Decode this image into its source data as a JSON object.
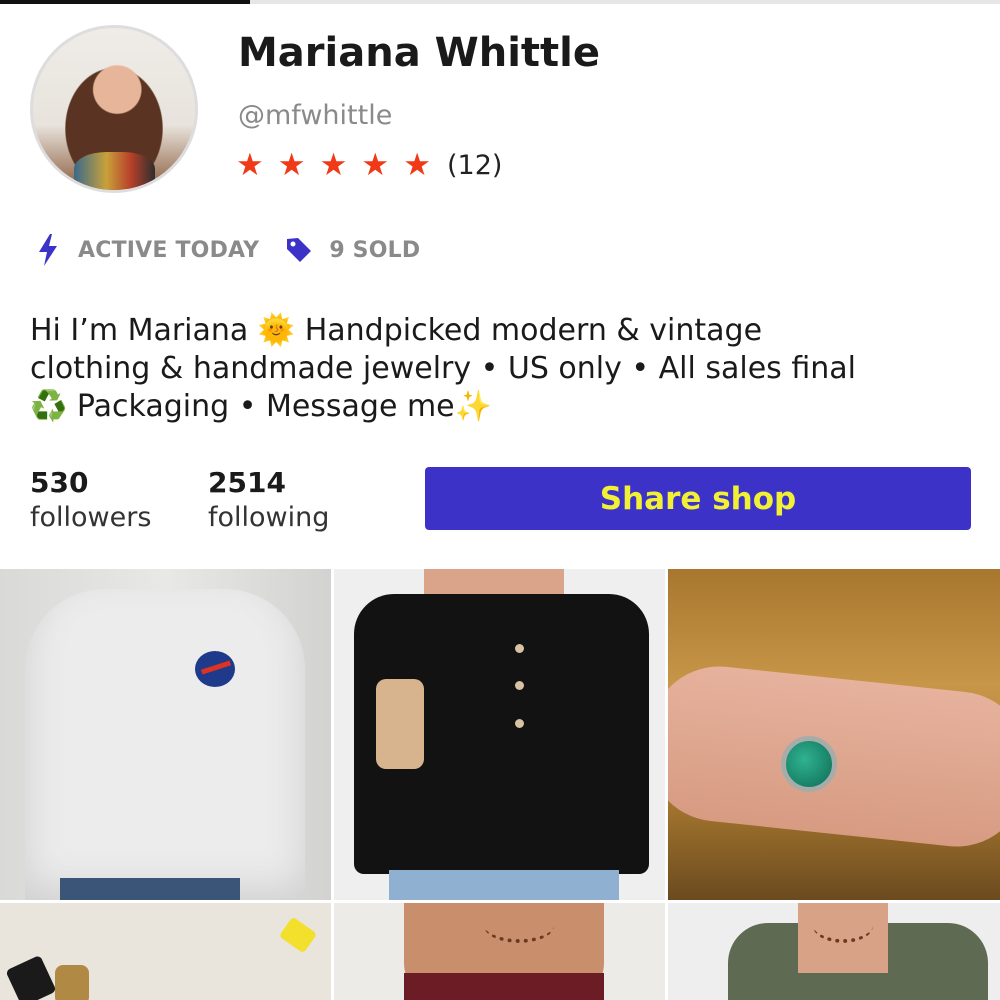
{
  "profile": {
    "name": "Mariana Whittle",
    "handle": "@mfwhittle",
    "rating": 5,
    "rating_count": "(12)",
    "star_color": "#f03a17"
  },
  "meta": {
    "active": {
      "icon": "lightning-icon",
      "label": "ACTIVE TODAY"
    },
    "sold": {
      "icon": "price-tag-icon",
      "label": "9 SOLD"
    },
    "icon_color": "#3c32c8"
  },
  "bio": {
    "line1": "Hi I’m Mariana 🌞 Handpicked modern & vintage",
    "line2": "clothing & handmade jewelry • US only • All sales final",
    "line3": "♻️ Packaging • Message me✨"
  },
  "stats": {
    "followers": {
      "count": "530",
      "label": "followers"
    },
    "following": {
      "count": "2514",
      "label": "following"
    }
  },
  "share_button": {
    "label": "Share shop",
    "bg_color": "#3c32c8",
    "text_color": "#f2f034"
  },
  "listings": [
    {
      "item": "gray NASA hoodie"
    },
    {
      "item": "black cap-sleeve top"
    },
    {
      "item": "malachite silver ring"
    },
    {
      "item": "jewelry flatlay"
    },
    {
      "item": "beaded necklace on burgundy top"
    },
    {
      "item": "beaded necklace on olive shirt"
    }
  ]
}
